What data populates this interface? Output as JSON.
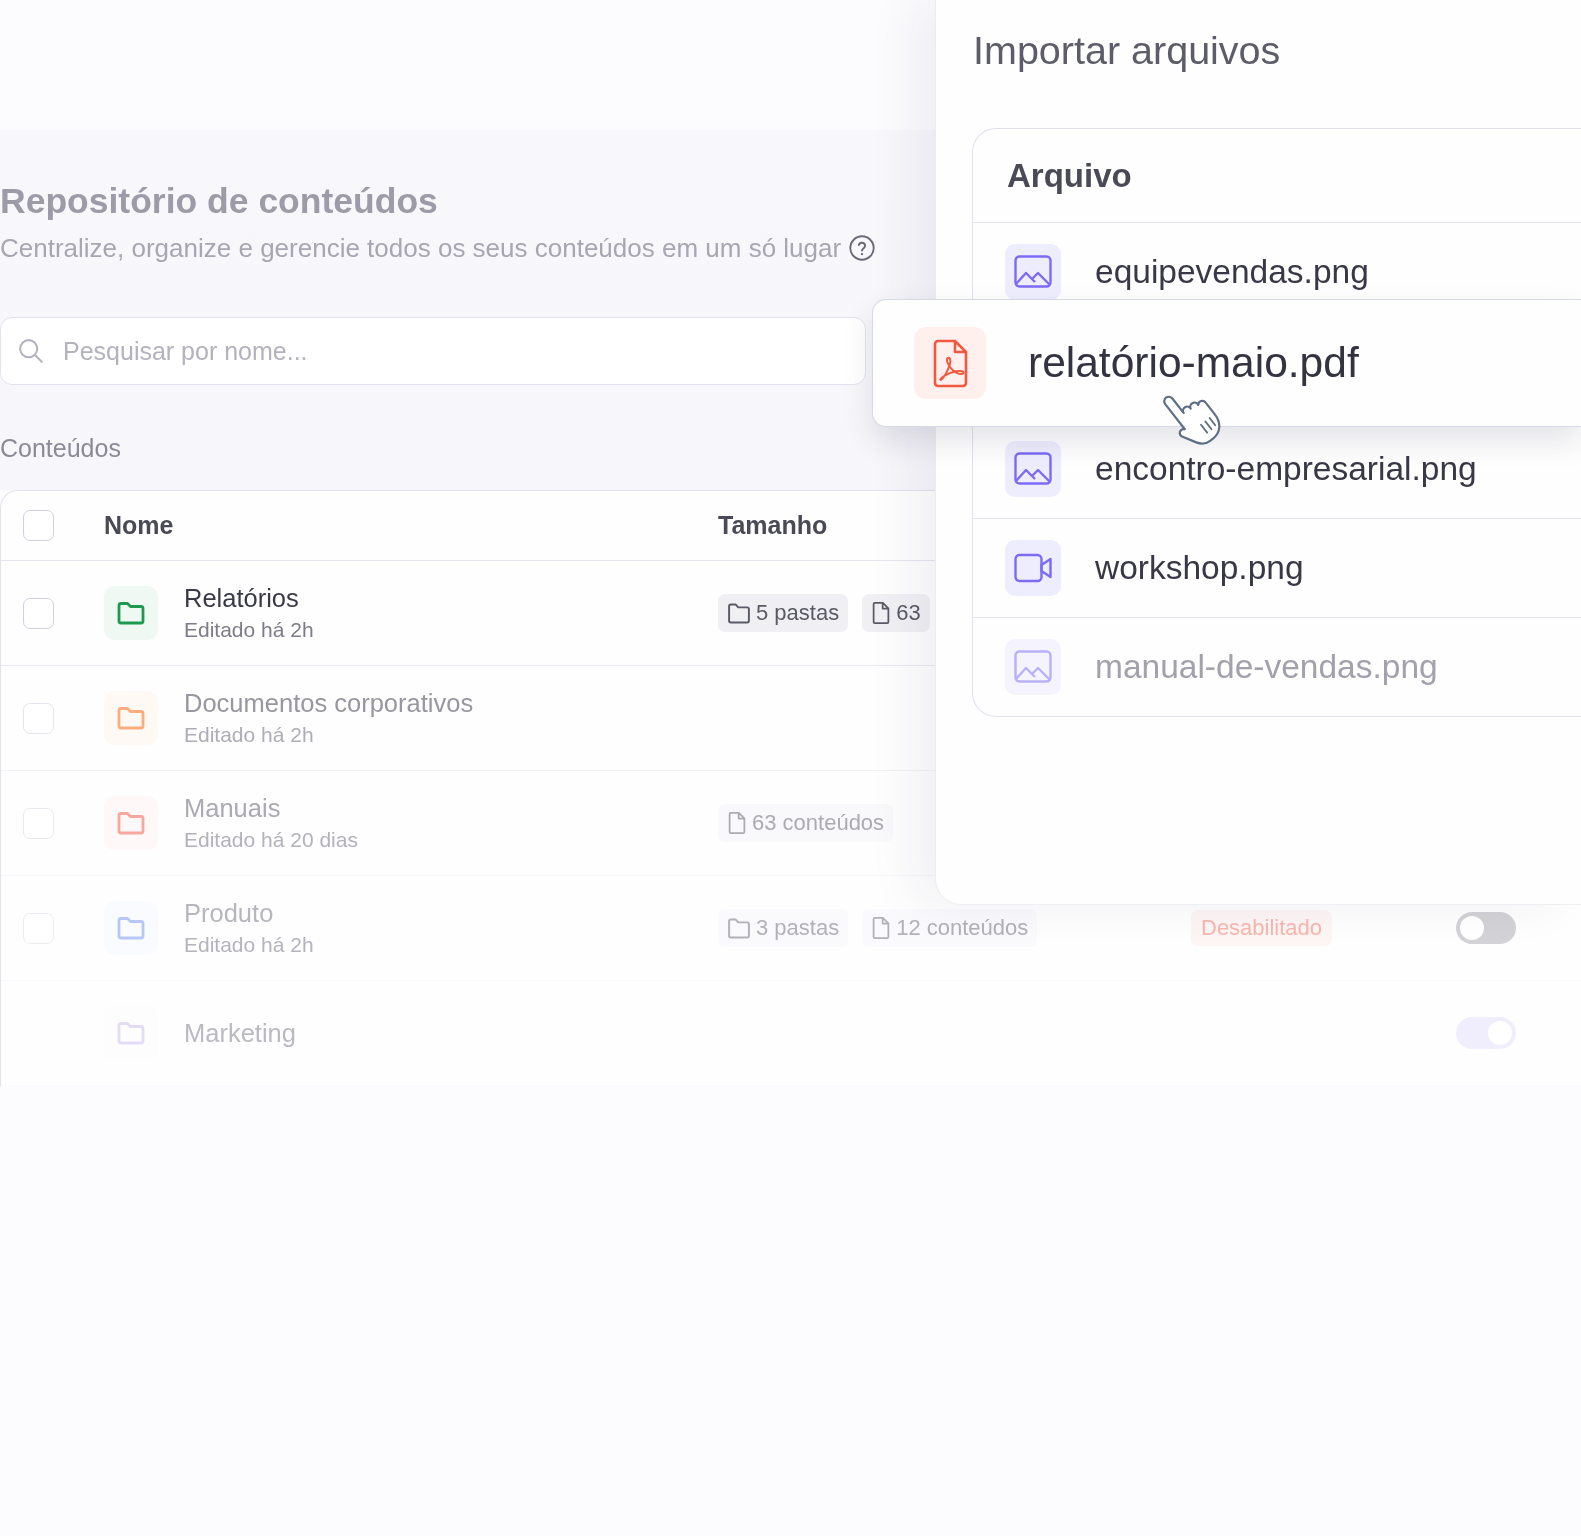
{
  "repository": {
    "title": "Repositório de conteúdos",
    "subtitle": "Centralize, organize e gerencie todos os seus conteúdos em um só lugar",
    "search": {
      "placeholder": "Pesquisar por nome..."
    },
    "section_label": "Conteúdos",
    "table": {
      "select_all_checked": false,
      "columns": [
        "Nome",
        "Tamanho"
      ],
      "rows": [
        {
          "name": "Relatórios",
          "edited": "Editado há 2h",
          "color": "#1e9a4f",
          "checked": false,
          "chips": [
            {
              "kind": "folders",
              "label": "5 pastas"
            },
            {
              "kind": "files",
              "label": "63"
            }
          ]
        },
        {
          "name": "Documentos corporativos",
          "edited": "Editado há 2h",
          "color": "#fbad7e",
          "checked": false
        },
        {
          "name": "Manuais",
          "edited": "Editado há 20 dias",
          "color": "#f7a79e",
          "checked": false,
          "chips": [
            {
              "kind": "files",
              "label": "63 conteúdos"
            }
          ]
        },
        {
          "name": "Produto",
          "edited": "Editado há 2h",
          "color": "#b8c8f4",
          "checked": false,
          "chips": [
            {
              "kind": "folders",
              "label": "3 pastas"
            },
            {
              "kind": "files",
              "label": "12 conteúdos"
            }
          ],
          "status": "Desabilitado",
          "toggle_on": false
        },
        {
          "name": "Marketing",
          "color": "#e4dcf7",
          "toggle_on": true
        }
      ]
    }
  },
  "import_panel": {
    "title": "Importar arquivos",
    "column": "Arquivo",
    "files": [
      {
        "name": "equipevendas.png",
        "kind": "image",
        "dragging": false,
        "dimmed": false
      },
      {
        "name": "relatório-maio.pdf",
        "kind": "pdf",
        "dragging": true,
        "dimmed": false
      },
      {
        "name": "encontro-empresarial.png",
        "kind": "image",
        "dragging": false,
        "dimmed": false
      },
      {
        "name": "workshop.png",
        "kind": "video",
        "dragging": false,
        "dimmed": false
      },
      {
        "name": "manual-de-vendas.png",
        "kind": "image",
        "dragging": false,
        "dimmed": true
      }
    ]
  }
}
